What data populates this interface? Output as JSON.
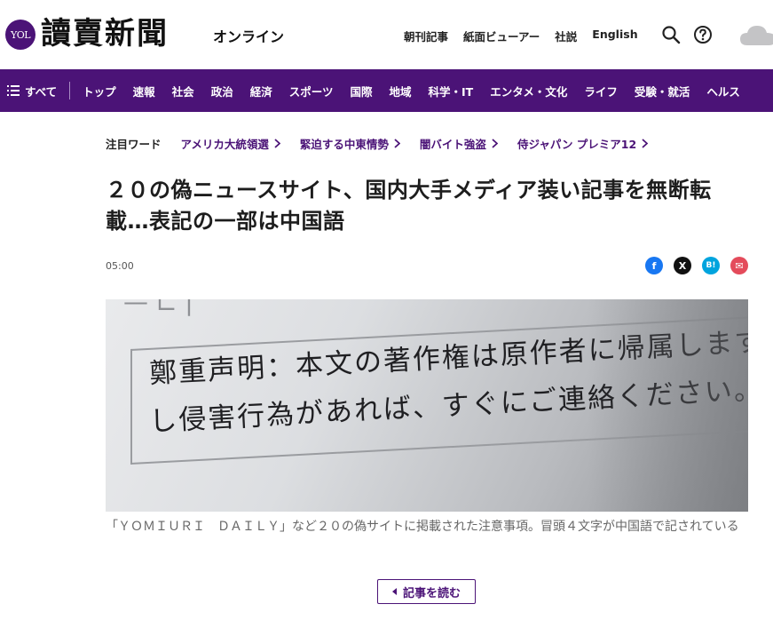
{
  "header": {
    "badge": "YOL",
    "logo": "讀賣新聞",
    "logo_sub": "オンライン",
    "links": [
      "朝刊記事",
      "紙面ビューアー",
      "社説",
      "English"
    ]
  },
  "nav": {
    "all_label": "すべて",
    "items": [
      "トップ",
      "速報",
      "社会",
      "政治",
      "経済",
      "スポーツ",
      "国際",
      "地域",
      "科学・IT",
      "エンタメ・文化",
      "ライフ",
      "受験・就活",
      "ヘルス"
    ]
  },
  "trending": {
    "label": "注目ワード",
    "items": [
      "アメリカ大統領選",
      "緊迫する中東情勢",
      "闇バイト強盗",
      "侍ジャパン プレミア12"
    ]
  },
  "article": {
    "headline": "２０の偽ニュースサイト、国内大手メディア装い記事を無断転載…表記の一部は中国語",
    "time": "05:00",
    "photo_line1": "鄭重声明：本文の著作権は原作者に帰属します。記",
    "photo_line2": "し侵害行為があれば、すぐにご連絡ください。修正",
    "caption": "「ＹＯＭＩＵＲＩ　ＤＡＩＬＹ」など２０の偽サイトに掲載された注意事項。冒頭４文字が中国語で記されている",
    "read_button": "記事を読む"
  },
  "share": {
    "fb": "f",
    "x": "X",
    "hatena": "B!",
    "mail": "✉"
  },
  "colors": {
    "brand": "#4b1377"
  }
}
